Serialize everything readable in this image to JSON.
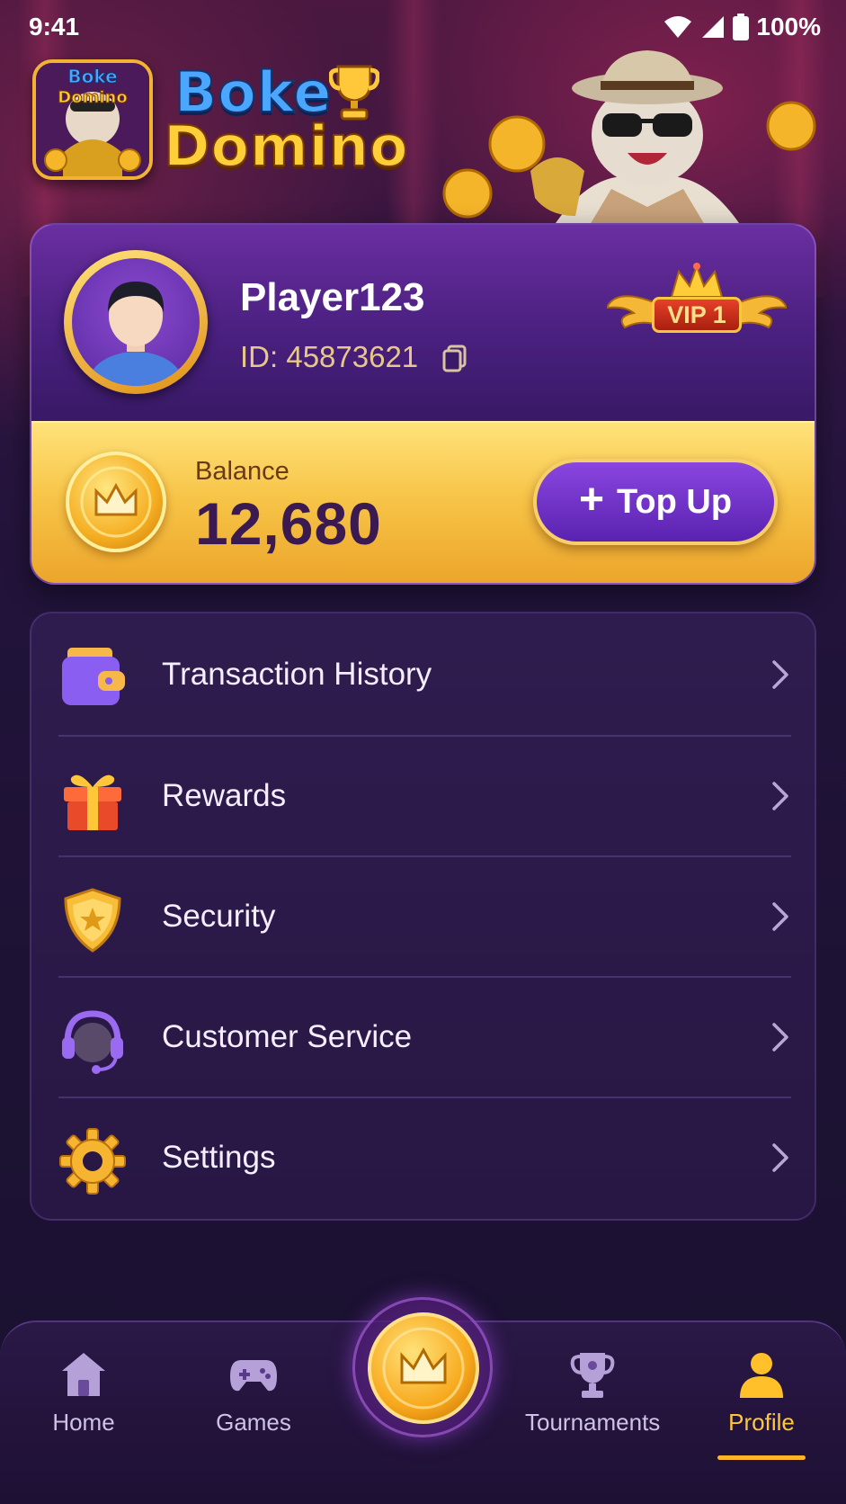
{
  "status_bar": {
    "time": "9:41",
    "battery": "100%"
  },
  "brand": {
    "line1": "Boke",
    "line2": "Domino"
  },
  "profile": {
    "name": "Player123",
    "id_text": "ID: 45873621",
    "vip": "VIP 1"
  },
  "balance": {
    "label": "Balance",
    "value": "12,680",
    "topup_label": "Top Up"
  },
  "menu": {
    "items": [
      {
        "label": "Transaction History",
        "icon": "wallet-icon"
      },
      {
        "label": "Rewards",
        "icon": "gift-icon"
      },
      {
        "label": "Security",
        "icon": "shield-icon"
      },
      {
        "label": "Customer Service",
        "icon": "headset-icon"
      },
      {
        "label": "Settings",
        "icon": "gear-icon"
      }
    ]
  },
  "nav": {
    "items": [
      {
        "label": "Home",
        "icon": "home-icon"
      },
      {
        "label": "Games",
        "icon": "gamepad-icon"
      },
      {
        "label": "Tournaments",
        "icon": "trophy-icon"
      },
      {
        "label": "Profile",
        "icon": "user-icon",
        "active": true
      }
    ],
    "center_icon": "crown-coin-icon"
  },
  "colors": {
    "accent_gold": "#ffc63a",
    "primary_purple": "#6a2ea0",
    "background": "#1c1030"
  }
}
